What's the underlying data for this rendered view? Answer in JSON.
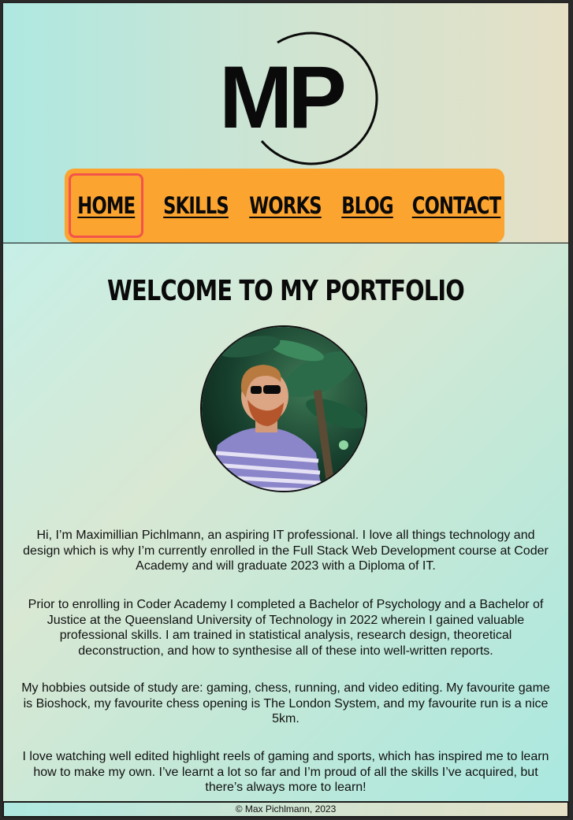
{
  "site": {
    "logo_text": "MP"
  },
  "nav": {
    "items": [
      {
        "label": "HOME",
        "active": true
      },
      {
        "label": "SKILLS",
        "active": false
      },
      {
        "label": "WORKS",
        "active": false
      },
      {
        "label": "BLOG",
        "active": false
      },
      {
        "label": "CONTACT",
        "active": false
      }
    ]
  },
  "main": {
    "title": "WELCOME TO MY PORTFOLIO",
    "paragraphs": [
      "Hi, I’m Maximillian Pichlmann, an aspiring IT professional. I love all things technology and design which is why I’m currently enrolled in the Full Stack Web Development course at Coder Academy and will graduate 2023 with a Diploma of IT.",
      "Prior to enrolling in Coder Academy I completed a Bachelor of Psychology and a Bachelor of Justice at the Queensland University of Technology in 2022 wherein I gained valuable professional skills. I am trained in statistical analysis, research design, theoretical deconstruction, and how to synthesise all of these into well-written reports.",
      "My hobbies outside of study are: gaming, chess, running, and video editing. My favourite game is Bioshock, my favourite chess opening is The London System, and my favourite run is a nice 5km.",
      "I love watching well edited highlight reels of gaming and sports, which has inspired me to learn how to make my own. I’ve learnt a lot so far and I’m proud of all the skills I’ve acquired, but there’s always more to learn!"
    ]
  },
  "footer": {
    "copyright": "© Max Pichlmann, 2023"
  },
  "colors": {
    "nav_bg": "#fca430",
    "nav_active_border": "#f2544b",
    "text": "#0a0a0a"
  }
}
